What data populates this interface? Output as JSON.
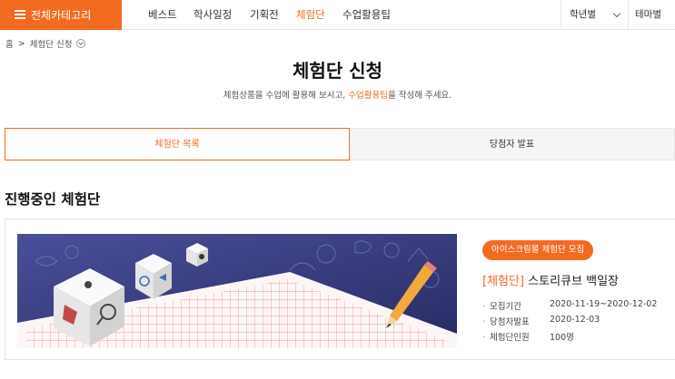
{
  "nav": {
    "category_button": "전체카테고리",
    "menu": [
      "베스트",
      "학사일정",
      "기획전",
      "체험단",
      "수업활용팁"
    ],
    "active_menu": "체험단",
    "grade_select": "학년별",
    "theme": "테마별",
    "accent_color": "#f26b21"
  },
  "breadcrumb": {
    "home": "홈",
    "separator": ">",
    "current": "체험단 신청"
  },
  "page": {
    "title": "체험단 신청",
    "subtitle_before": "체험상품을 수업에 활용해 보시고, ",
    "subtitle_highlight": "수업활용팁",
    "subtitle_after": "을 작성해 주세요."
  },
  "tabs": [
    {
      "label": "체험단 목록",
      "active": true
    },
    {
      "label": "당첨자 발표",
      "active": false
    }
  ],
  "section": {
    "title": "진행중인 체험단"
  },
  "campaign": {
    "badge": "아이스크림몰 체험단 모집",
    "category": "[체험단]",
    "name": "스토리큐브 백일장",
    "info": [
      {
        "label": "모집기간",
        "value": "2020-11-19~2020-12-02"
      },
      {
        "label": "당첨자발표",
        "value": "2020-12-03"
      },
      {
        "label": "체험단인원",
        "value": "100명"
      }
    ]
  }
}
